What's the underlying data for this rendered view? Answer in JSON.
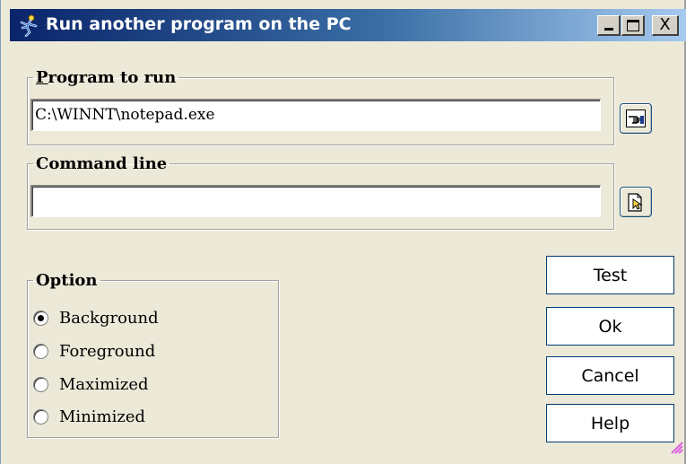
{
  "window": {
    "title": "Run another program on the PC",
    "controls": {
      "minimize": "_",
      "maximize": "□",
      "close": "X"
    }
  },
  "program": {
    "group_label": "Program to run",
    "value": "C:\\WINNT\\notepad.exe",
    "browse_icon": "hand-pointer-icon"
  },
  "command_line": {
    "group_label": "Command line",
    "value": "",
    "browse_icon": "document-pointer-icon"
  },
  "option": {
    "group_label": "Option",
    "items": [
      {
        "label": "Background",
        "checked": true
      },
      {
        "label": "Foreground",
        "checked": false
      },
      {
        "label": "Maximized",
        "checked": false
      },
      {
        "label": "Minimized",
        "checked": false
      }
    ]
  },
  "buttons": {
    "test": "Test",
    "ok": "Ok",
    "cancel": "Cancel",
    "help": "Help"
  },
  "colors": {
    "title_start": "#0a246a",
    "title_end": "#a6caf0",
    "dialog_bg": "#ece9d8",
    "button_border": "#003c74",
    "resize_grip": "#e060e0"
  }
}
